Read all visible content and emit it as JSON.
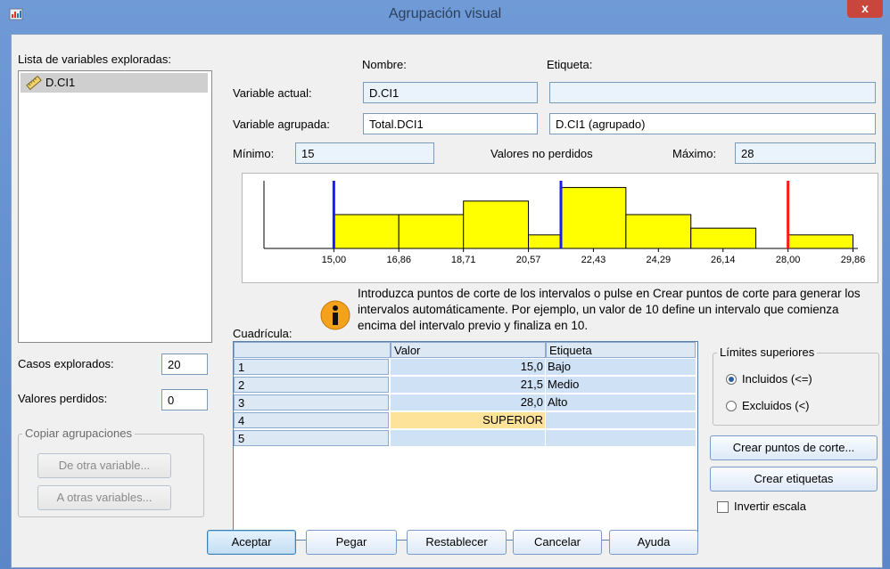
{
  "window": {
    "title": "Agrupación visual",
    "close_symbol": "x"
  },
  "left": {
    "list_label": "Lista de variables exploradas:",
    "variables": [
      {
        "name": "D.CI1",
        "icon": "ruler-icon"
      }
    ],
    "cases_label": "Casos explorados:",
    "cases_value": "20",
    "missing_label": "Valores perdidos:",
    "missing_value": "0",
    "copy_group": {
      "legend": "Copiar agrupaciones",
      "from_other": "De otra variable...",
      "to_other": "A otras variables..."
    }
  },
  "header": {
    "name_col": "Nombre:",
    "label_col": "Etiqueta:"
  },
  "current": {
    "label": "Variable actual:",
    "name": "D.CI1",
    "etiqueta": ""
  },
  "binned": {
    "label": "Variable agrupada:",
    "name": "Total.DCI1",
    "etiqueta": "D.CI1 (agrupado)"
  },
  "stats": {
    "min_label": "Mínimo:",
    "min_value": "15",
    "nonmissing_label": "Valores no perdidos",
    "max_label": "Máximo:",
    "max_value": "28"
  },
  "chart_data": {
    "type": "bar",
    "x_ticks": [
      "15,00",
      "16,86",
      "18,71",
      "20,57",
      "22,43",
      "24,29",
      "26,14",
      "28,00",
      "29,86"
    ],
    "bin_width": 1.86,
    "bars": [
      {
        "x_start": 15.0,
        "height": 5
      },
      {
        "x_start": 16.86,
        "height": 5
      },
      {
        "x_start": 18.71,
        "height": 7
      },
      {
        "x_start": 20.57,
        "height": 2
      },
      {
        "x_start": 21.5,
        "height": 9
      },
      {
        "x_start": 23.36,
        "height": 5
      },
      {
        "x_start": 25.22,
        "height": 3
      },
      {
        "x_start": 28.0,
        "height": 2
      }
    ],
    "xlim": [
      13.0,
      30.0
    ],
    "ylim": [
      0,
      10
    ],
    "cutpoints": [
      {
        "value": 15.0,
        "color": "#1a1aff"
      },
      {
        "value": 21.5,
        "color": "#1a1aff"
      },
      {
        "value": 28.0,
        "color": "#ff1a1a"
      }
    ],
    "bar_color": "#ffff00"
  },
  "info_text": "Introduzca puntos de corte de los intervalos o pulse en Crear puntos de corte para generar los intervalos automáticamente. Por ejemplo, un valor de 10 define un intervalo que comienza encima del intervalo previo y finaliza en 10.",
  "grid": {
    "label": "Cuadrícula:",
    "columns": [
      "Valor",
      "Etiqueta"
    ],
    "rows": [
      {
        "n": "1",
        "value": "15,0",
        "label": "Bajo"
      },
      {
        "n": "2",
        "value": "21,5",
        "label": "Medio"
      },
      {
        "n": "3",
        "value": "28,0",
        "label": "Alto"
      },
      {
        "n": "4",
        "value": "SUPERIOR",
        "label": ""
      },
      {
        "n": "5",
        "value": "",
        "label": ""
      }
    ]
  },
  "limits": {
    "legend": "Límites superiores",
    "included": "Incluidos (<=)",
    "excluded": "Excluidos (<)"
  },
  "actions": {
    "make_cutpoints": "Crear puntos de corte...",
    "make_labels": "Crear etiquetas",
    "reverse": "Invertir escala"
  },
  "footer": {
    "ok": "Aceptar",
    "paste": "Pegar",
    "reset": "Restablecer",
    "cancel": "Cancelar",
    "help": "Ayuda"
  }
}
